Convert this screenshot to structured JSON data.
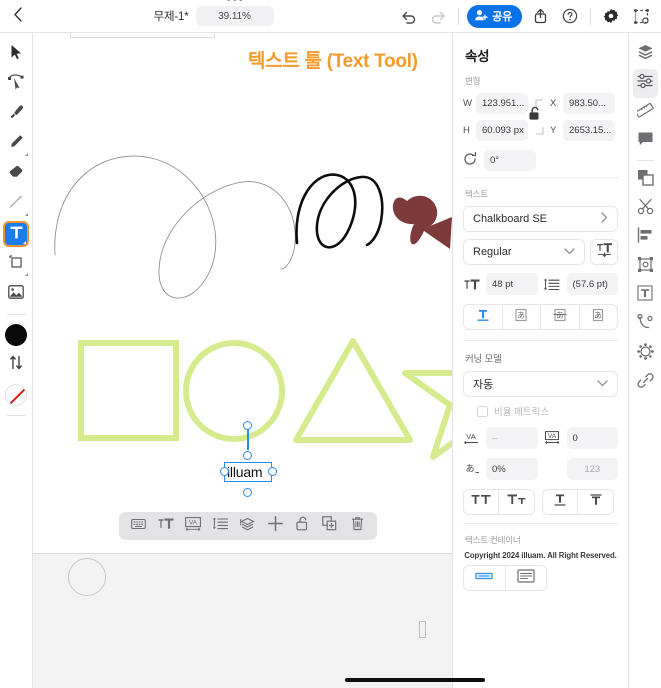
{
  "topbar": {
    "back_icon": "chevron-left-icon",
    "doc_title": "무제-1*",
    "zoom_level": "39.11%",
    "undo_icon": "undo-icon",
    "redo_icon": "redo-icon",
    "share_label": "공유",
    "export_icon": "export-icon",
    "help_icon": "help-icon",
    "settings_icon": "gear-icon",
    "transform_icon": "transform-icon"
  },
  "left_toolbar": {
    "tools": [
      {
        "name": "select-tool",
        "icon": "cursor-arrow-icon"
      },
      {
        "name": "node-select-tool",
        "icon": "node-select-icon"
      },
      {
        "name": "pen-tool",
        "icon": "pen-icon"
      },
      {
        "name": "pencil-tool",
        "icon": "pencil-icon"
      },
      {
        "name": "eraser-tool",
        "icon": "eraser-icon"
      },
      {
        "name": "line-tool",
        "icon": "line-icon"
      },
      {
        "name": "text-tool",
        "icon": "text-T-icon",
        "active": true
      },
      {
        "name": "shape-tool",
        "icon": "shape-icon"
      },
      {
        "name": "image-tool",
        "icon": "image-icon"
      }
    ],
    "fill_swatch": "#0a0a0a",
    "swap_icon": "swap-vertical-icon",
    "stroke_swatch_none": "no-color"
  },
  "canvas": {
    "annotation": "텍스트 툴 (Text Tool)",
    "annotation_color": "#f49b2e",
    "selected_text": "illuam",
    "shape_green": "#d5eb8d",
    "shape_darkred": "#7d3a3a",
    "shapes": [
      "square",
      "circle",
      "triangle",
      "star"
    ],
    "scribbles": [
      "thin-gray-scribble",
      "black-calligraphy-scribble"
    ]
  },
  "float_toolbar": {
    "items": [
      {
        "name": "keyboard-button",
        "icon": "keyboard-icon"
      },
      {
        "name": "font-size-button",
        "icon": "font-size-icon"
      },
      {
        "name": "kerning-button",
        "icon": "kerning-VA-icon"
      },
      {
        "name": "line-spacing-button",
        "icon": "line-spacing-icon"
      },
      {
        "name": "layers-button",
        "icon": "layers-icon"
      },
      {
        "name": "move-button",
        "icon": "move-cross-icon"
      },
      {
        "name": "lock-button",
        "icon": "unlock-icon"
      },
      {
        "name": "duplicate-button",
        "icon": "duplicate-icon"
      },
      {
        "name": "delete-button",
        "icon": "trash-icon"
      }
    ]
  },
  "properties": {
    "title": "속성",
    "transform": {
      "section_label": "변형",
      "w_label": "W",
      "w_value": "123.951...",
      "h_label": "H",
      "h_value": "60.093 px",
      "x_label": "X",
      "x_value": "983.50...",
      "y_label": "Y",
      "y_value": "2653.15...",
      "lock_icon": "unlock-icon",
      "rotate_icon": "rotate-icon",
      "rotate_value": "0°"
    },
    "text": {
      "section_label": "텍스트",
      "font_family": "Chalkboard SE",
      "font_style": "Regular",
      "font_size": "48 pt",
      "line_height": "(57.6 pt)",
      "font_options_icon": "font-variant-icon",
      "size_icon": "font-size-icon",
      "line_icon": "line-height-icon",
      "orientation_buttons": [
        {
          "name": "horizontal-text-button",
          "icon": "horizontal-text-icon",
          "active": true
        },
        {
          "name": "vertical-text-button",
          "icon": "vertical-text-icon",
          "active": false
        },
        {
          "name": "tate-chu-yoko-button",
          "icon": "tate-chu-yoko-icon",
          "active": false
        },
        {
          "name": "rotated-text-button",
          "icon": "rotated-text-icon",
          "active": false
        }
      ]
    },
    "kerning": {
      "section_label": "커닝 모델",
      "mode": "자동",
      "proportional_metrics_label": "비율 메트릭스",
      "tracking_icon": "VA-tracking-icon",
      "tracking_value": "–",
      "kerning_icon": "VA-kerning-icon",
      "kerning_value": "0",
      "scale_icon": "glyph-scale-icon",
      "scale_value": "0%",
      "baseline_icon": "baseline-shift-icon",
      "baseline_placeholder": "123",
      "case_buttons": [
        {
          "name": "all-caps-button",
          "icon": "all-caps-icon"
        },
        {
          "name": "small-caps-button",
          "icon": "small-caps-icon"
        },
        {
          "name": "underline-button",
          "icon": "underline-icon"
        },
        {
          "name": "strikethrough-button",
          "icon": "strikethrough-icon"
        }
      ]
    },
    "container": {
      "section_label": "텍스트 컨테이너",
      "copyright": "Copyright 2024 illuam. All Right Reserved.",
      "buttons": [
        {
          "name": "fixed-width-button",
          "icon": "fixed-width-icon",
          "active": true
        },
        {
          "name": "auto-box-button",
          "icon": "auto-box-icon",
          "active": false
        }
      ]
    }
  },
  "right_rail": {
    "items": [
      {
        "name": "layers-panel-button",
        "icon": "layers-icon",
        "selected": false
      },
      {
        "name": "properties-panel-button",
        "icon": "sliders-icon",
        "selected": true
      },
      {
        "name": "ruler-button",
        "icon": "ruler-icon",
        "selected": false
      },
      {
        "name": "comment-button",
        "icon": "comment-icon",
        "selected": false
      },
      {
        "name": "duplicate-panel-button",
        "icon": "copy-icon",
        "selected": false
      },
      {
        "name": "cut-button",
        "icon": "scissors-icon",
        "selected": false
      },
      {
        "name": "align-button",
        "icon": "align-icon",
        "selected": false
      },
      {
        "name": "transform-panel-button",
        "icon": "transform-icon",
        "selected": false
      },
      {
        "name": "text-panel-button",
        "icon": "text-T-icon",
        "selected": false
      },
      {
        "name": "path-button",
        "icon": "path-node-icon",
        "selected": false
      },
      {
        "name": "effects-button",
        "icon": "effects-gear-icon",
        "selected": false
      },
      {
        "name": "link-button",
        "icon": "link-icon",
        "selected": false
      }
    ]
  }
}
